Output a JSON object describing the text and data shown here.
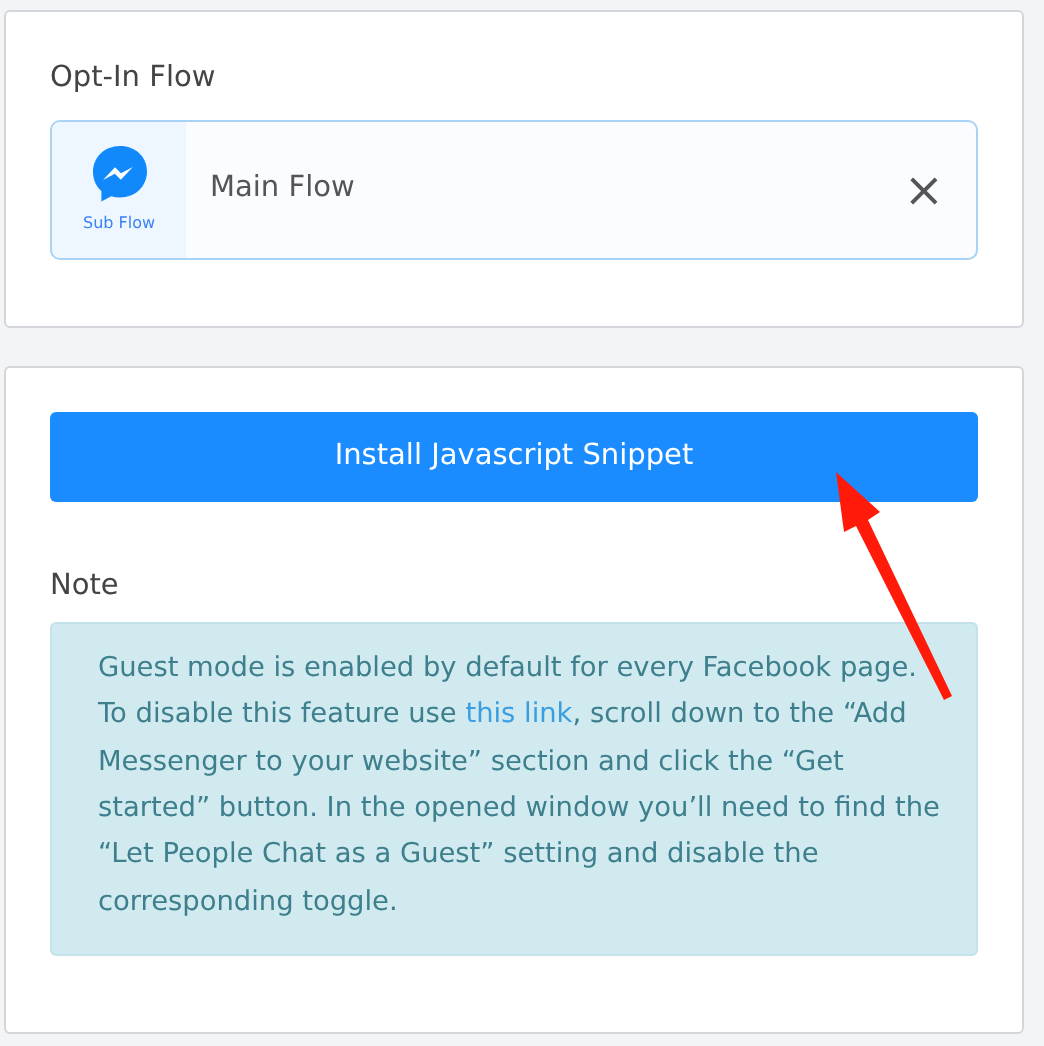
{
  "opt_in_flow": {
    "title": "Opt-In Flow",
    "flow": {
      "badge": "Sub Flow",
      "name": "Main Flow",
      "remove": "×"
    }
  },
  "install_button": "Install Javascript Snippet",
  "note": {
    "label": "Note",
    "before": "Guest mode is enabled by default for every Facebook page. To disable this feature use ",
    "link": "this link",
    "after": ", scroll down to the “Add Messenger to your website” section and click the “Get started” button. In the opened window you’ll need to find the “Let People Chat as a Guest” setting and disable the corresponding toggle."
  }
}
